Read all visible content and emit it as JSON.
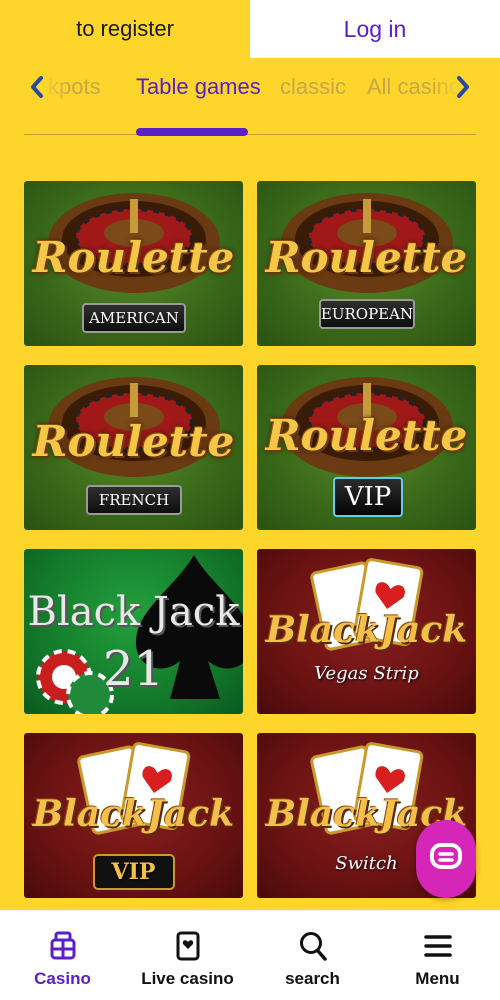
{
  "header": {
    "register_label": "to register",
    "login_label": "Log in"
  },
  "categories": {
    "tabs": [
      {
        "label": "Jackpots",
        "visible_text": "kpots",
        "active": false
      },
      {
        "label": "Table games",
        "active": true
      },
      {
        "label": "classic",
        "active": false
      },
      {
        "label": "All casino",
        "visible_text": "All casino",
        "active": false
      }
    ],
    "prev_icon": "chevron-left-icon",
    "next_icon": "chevron-right-icon"
  },
  "games": [
    {
      "title": "Roulette",
      "variant": "AMERICAN",
      "theme": "roulette-green"
    },
    {
      "title": "Roulette",
      "variant": "EUROPEAN",
      "theme": "roulette-green"
    },
    {
      "title": "Roulette",
      "variant": "FRENCH",
      "theme": "roulette-green"
    },
    {
      "title": "Roulette",
      "variant": "VIP",
      "theme": "roulette-green"
    },
    {
      "title": "Black Jack",
      "variant": "21",
      "theme": "blackjack-green"
    },
    {
      "title": "BlackJack",
      "variant": "Vegas Strip",
      "theme": "blackjack-red"
    },
    {
      "title": "BlackJack",
      "variant": "VIP",
      "theme": "blackjack-red"
    },
    {
      "title": "BlackJack",
      "variant": "Switch",
      "theme": "blackjack-red"
    }
  ],
  "chat": {
    "icon": "chat-bubble-icon"
  },
  "bottom_nav": {
    "items": [
      {
        "label": "Casino",
        "icon": "casino-chips-icon",
        "active": true
      },
      {
        "label": "Live casino",
        "icon": "playing-card-icon",
        "active": false
      },
      {
        "label": "search",
        "icon": "search-icon",
        "active": false
      },
      {
        "label": "Menu",
        "icon": "hamburger-menu-icon",
        "active": false
      }
    ]
  },
  "colors": {
    "background": "#fed52b",
    "accent": "#5a20c8",
    "chat": "#d626b8"
  }
}
